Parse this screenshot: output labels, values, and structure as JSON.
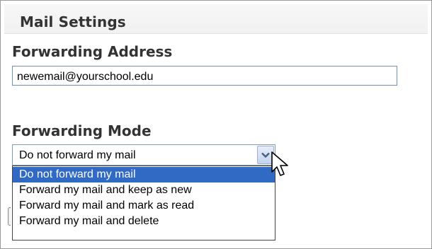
{
  "header": {
    "title": "Mail Settings"
  },
  "forwarding_address": {
    "label": "Forwarding Address",
    "value": "newemail@yourschool.edu"
  },
  "forwarding_mode": {
    "label": "Forwarding Mode",
    "selected": "Do not forward my mail",
    "options": [
      "Do not forward my mail",
      "Forward my mail and keep as new",
      "Forward my mail and mark as read",
      "Forward my mail and delete"
    ]
  },
  "colors": {
    "selection_highlight": "#316ac5",
    "input_border": "#7f9db9",
    "heading_text": "#333333"
  },
  "icons": {
    "dropdown_arrow": "chevron-down-icon",
    "cursor": "mouse-pointer-icon"
  }
}
